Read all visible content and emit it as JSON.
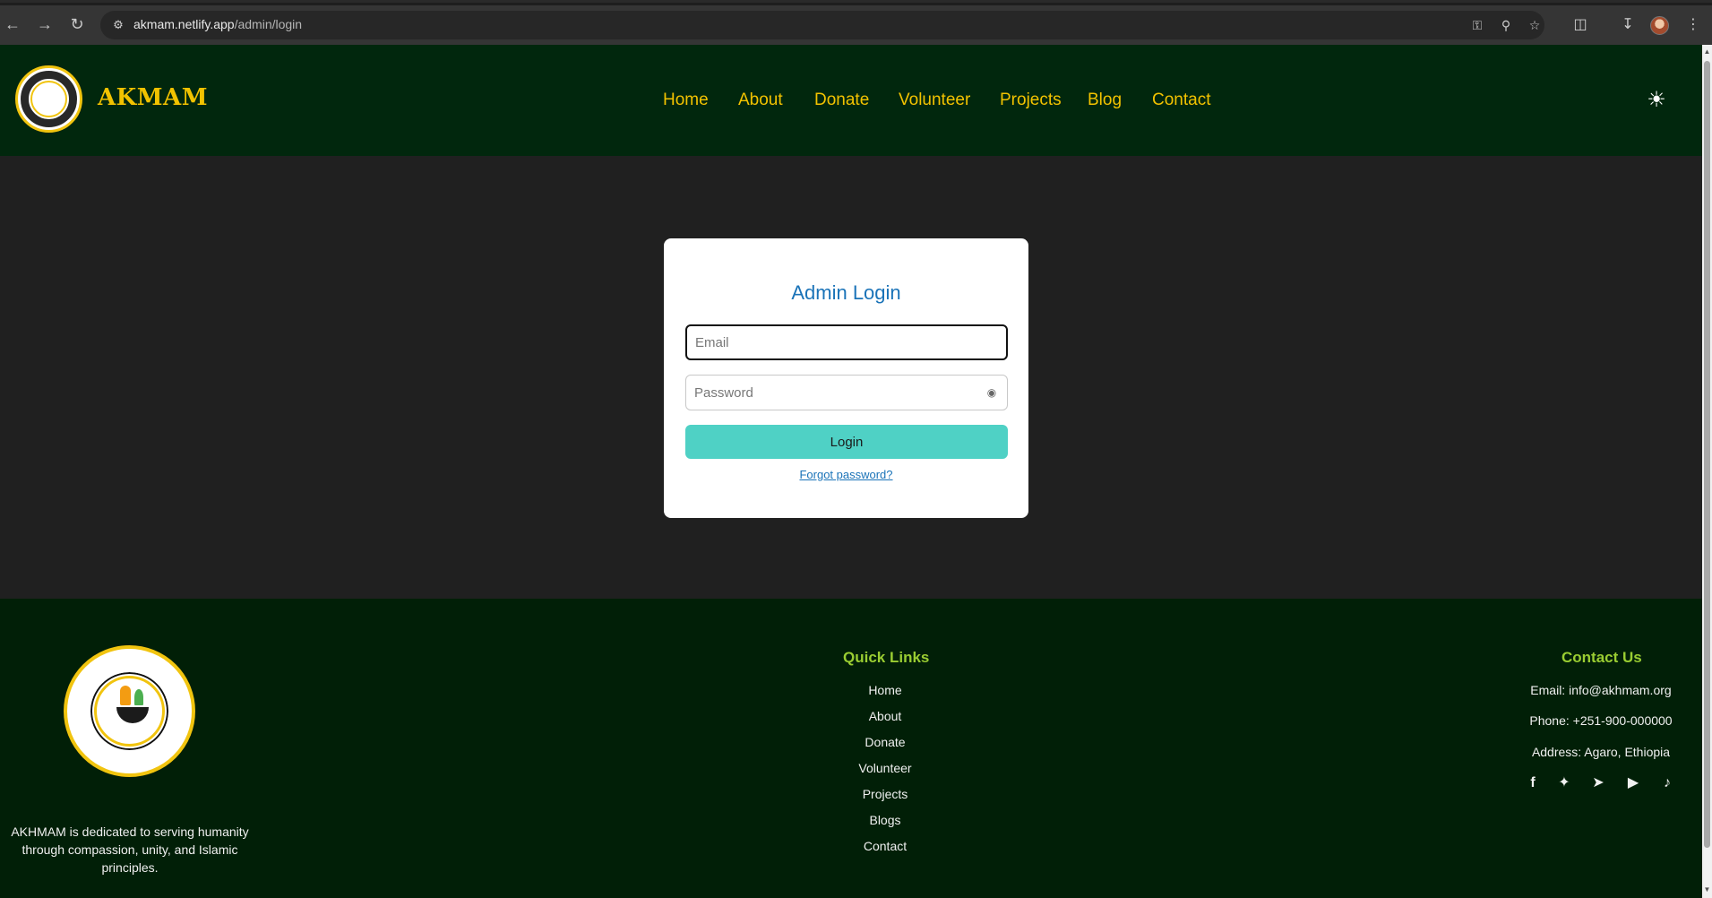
{
  "browser": {
    "url_host": "akmam.netlify.app",
    "url_path": "/admin/login",
    "icons": {
      "back": "arrow-left-icon",
      "forward": "arrow-right-icon",
      "reload": "reload-icon",
      "site_info": "site-info-icon",
      "password": "key-icon",
      "zoom": "zoom-icon",
      "bookmark": "star-icon",
      "extensions": "puzzle-icon",
      "downloads": "download-icon",
      "menu": "kebab-menu-icon"
    }
  },
  "header": {
    "site_name": "AKMAM",
    "nav": [
      "Home",
      "About",
      "Donate",
      "Volunteer",
      "Projects",
      "Blog",
      "Contact"
    ],
    "theme_toggle_icon": "sun-icon",
    "nav_color": "#f2c200",
    "background": "#01270d"
  },
  "login": {
    "title": "Admin Login",
    "email_placeholder": "Email",
    "password_placeholder": "Password",
    "password_toggle_icon": "eye-icon",
    "login_button": "Login",
    "forgot_password": "Forgot password?",
    "button_color": "#4fd1c5",
    "title_color": "#1a73b8"
  },
  "footer": {
    "about_text": "AKHMAM is dedicated to serving humanity through compassion, unity, and Islamic principles.",
    "quick_links_heading": "Quick Links",
    "quick_links": [
      "Home",
      "About",
      "Donate",
      "Volunteer",
      "Projects",
      "Blogs",
      "Contact"
    ],
    "contact_heading": "Contact Us",
    "contact": {
      "email": "Email: info@akhmam.org",
      "phone": "Phone: +251-900-000000",
      "address": "Address: Agaro, Ethiopia"
    },
    "social_icons": [
      "facebook-icon",
      "twitter-icon",
      "telegram-icon",
      "youtube-icon",
      "tiktok-icon"
    ],
    "heading_color": "#9acd32",
    "background": "#011f07"
  }
}
